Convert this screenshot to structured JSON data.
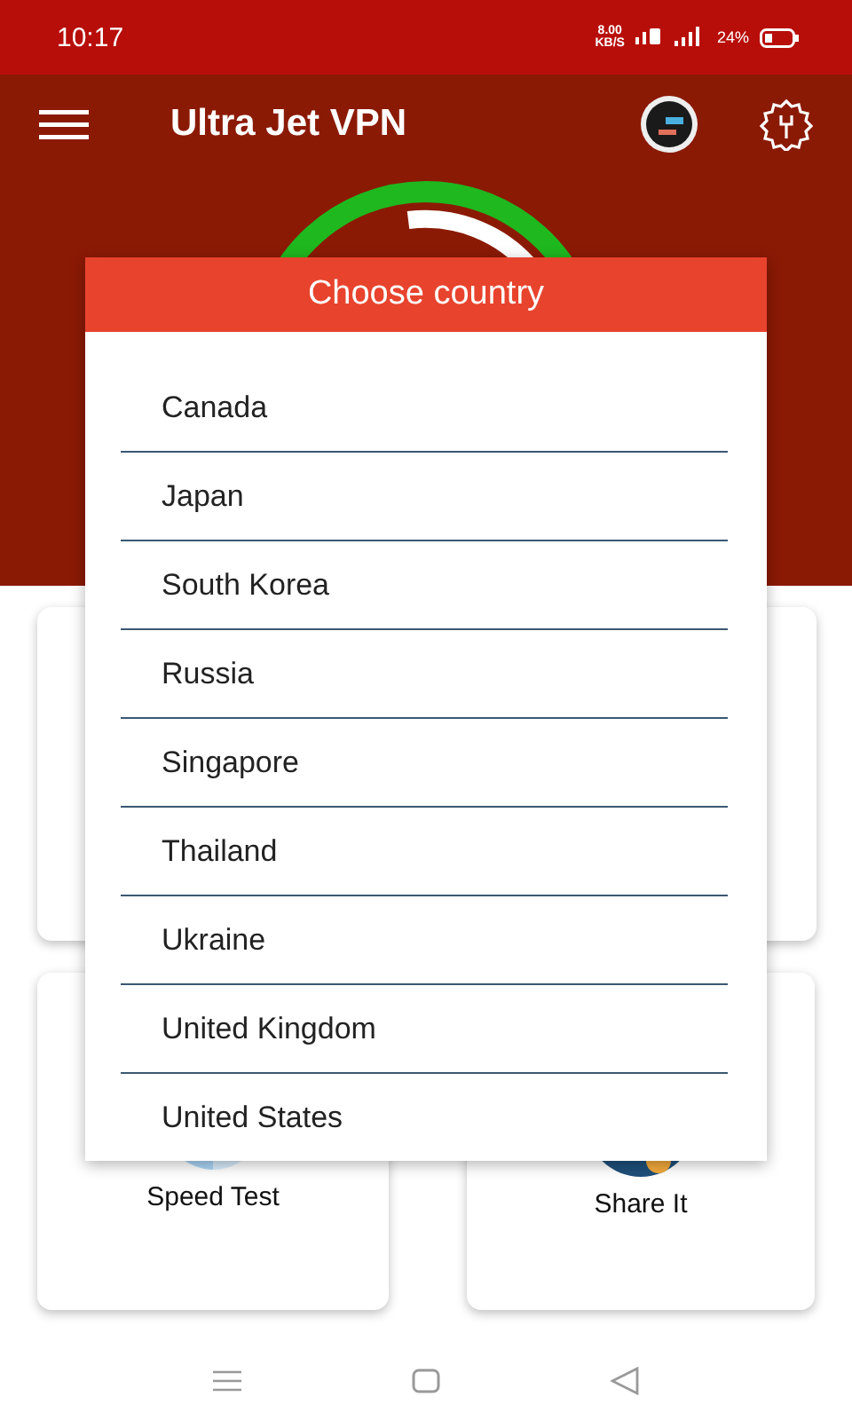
{
  "status_bar": {
    "time": "10:17",
    "net_speed": "8.00",
    "net_unit": "KB/S",
    "battery": "24%"
  },
  "app_bar": {
    "title": "Ultra Jet VPN"
  },
  "dialog": {
    "title": "Choose country",
    "countries": [
      "Canada",
      "Japan",
      "South Korea",
      "Russia",
      "Singapore",
      "Thailand",
      "Ukraine",
      "United Kingdom",
      "United States"
    ]
  },
  "cards": [
    {
      "label": "Speed Test",
      "kind": "speed"
    },
    {
      "label": "Share It",
      "kind": "share"
    }
  ]
}
